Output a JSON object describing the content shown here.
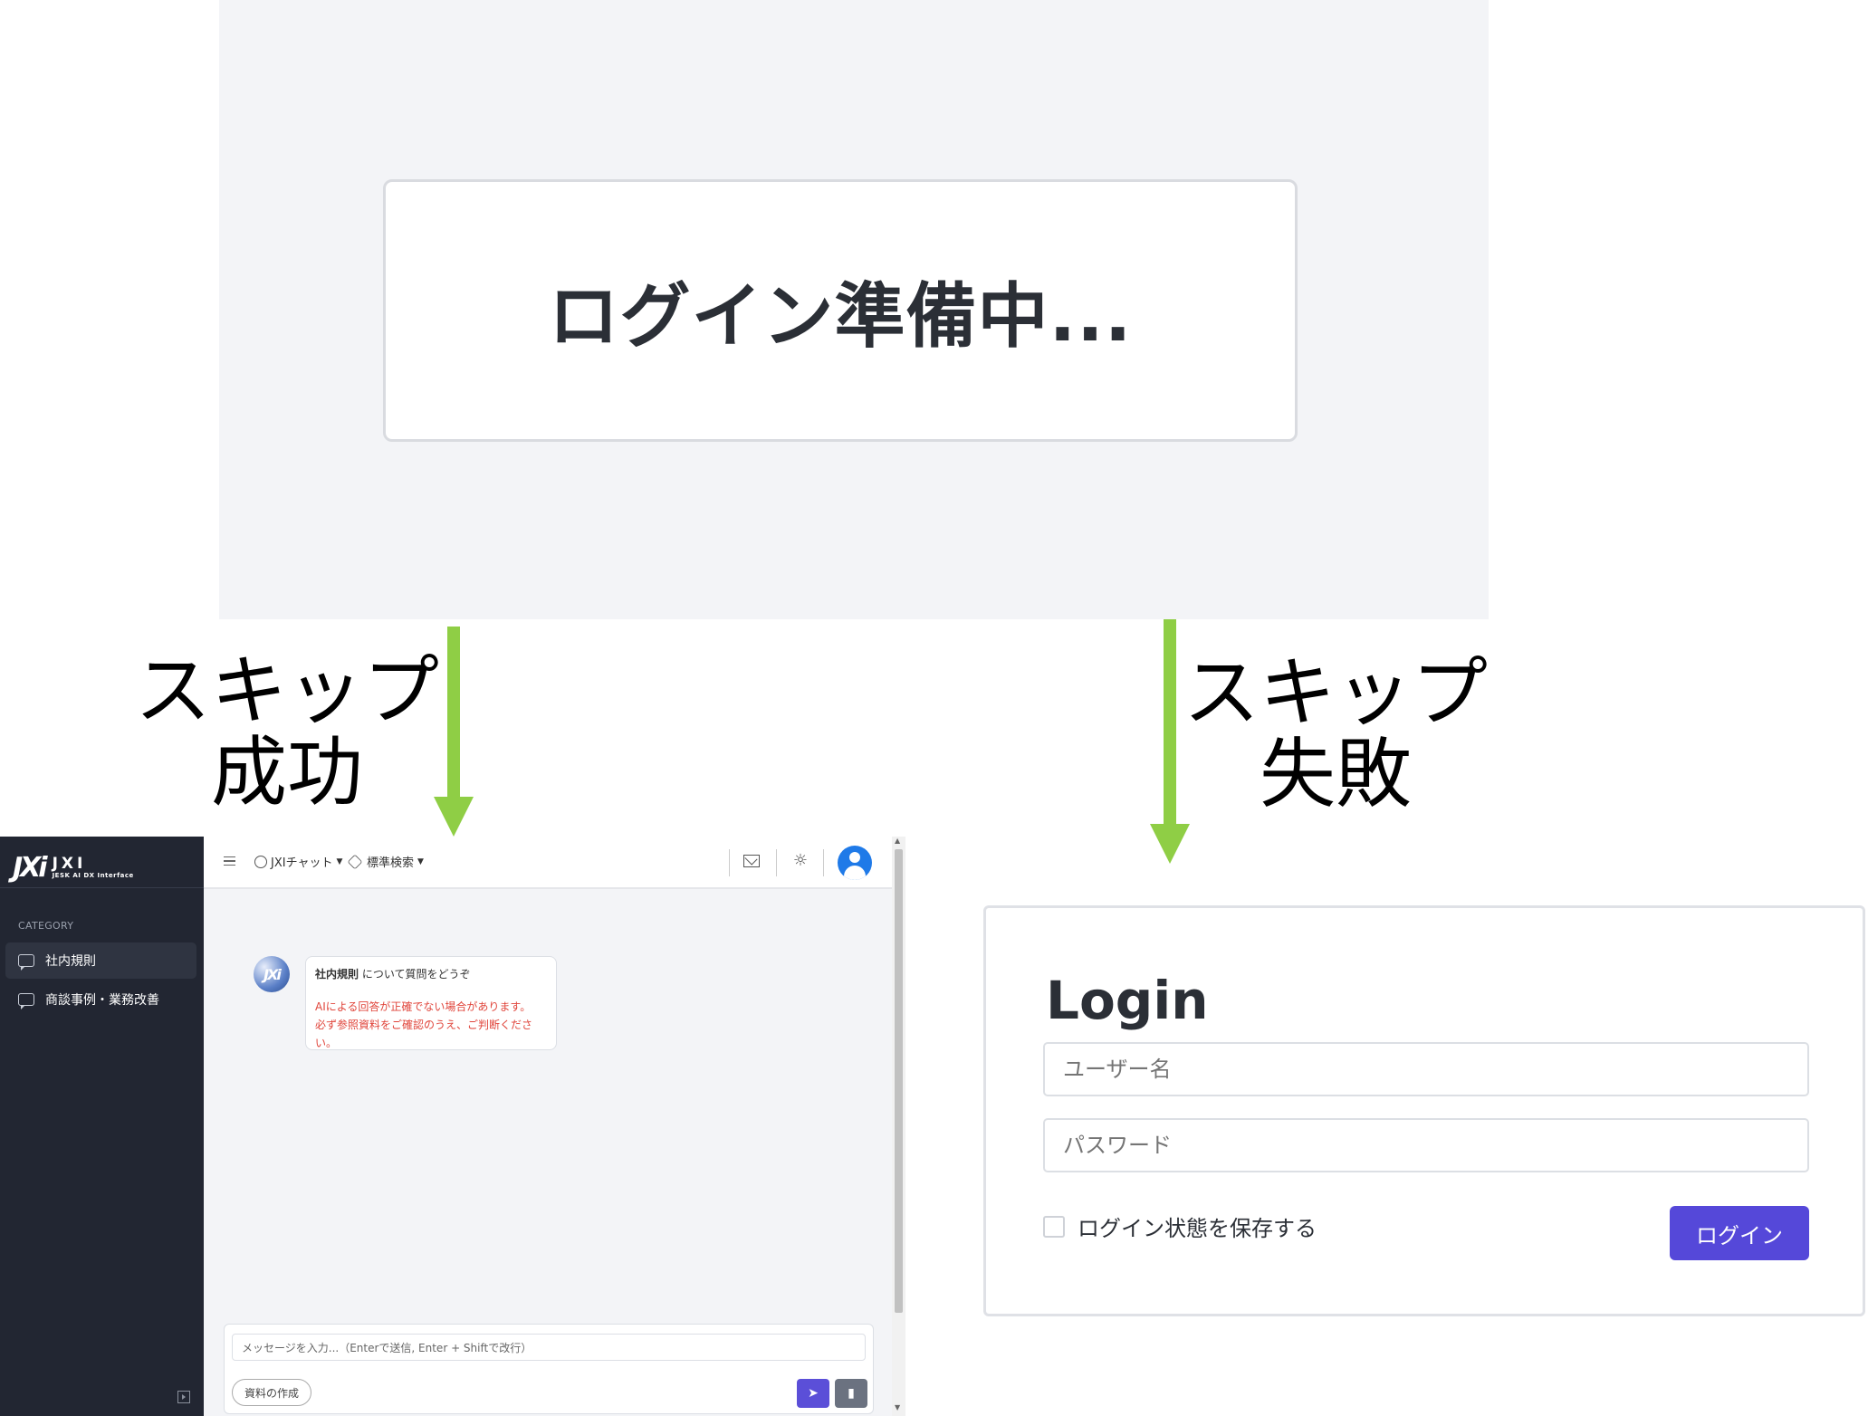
{
  "loading": {
    "text": "ログイン準備中..."
  },
  "labels": {
    "success_line1": "スキップ",
    "success_line2": "成功",
    "fail_line1": "スキップ",
    "fail_line2": "失敗"
  },
  "app": {
    "logo": {
      "mark": "JXi",
      "main": "JXI",
      "sub": "JESK AI DX Interface"
    },
    "sidebar": {
      "category_label": "CATEGORY",
      "items": [
        {
          "label": "社内規則",
          "active": true
        },
        {
          "label": "商談事例・業務改善",
          "active": false
        }
      ]
    },
    "topbar": {
      "chat_label": "JXIチャット",
      "search_label": "標準検索"
    },
    "bubble": {
      "title_bold": "社内規則",
      "title_rest": " について質問をどうぞ",
      "warn_line1": "AIによる回答が正確でない場合があります。",
      "warn_line2": "必ず参照資料をご確認のうえ、ご判断ください。"
    },
    "input": {
      "placeholder": "メッセージを入力...（Enterで送信, Enter + Shiftで改行）",
      "doc_button": "資料の作成"
    }
  },
  "login": {
    "title": "Login",
    "username_placeholder": "ユーザー名",
    "password_placeholder": "パスワード",
    "remember_label": "ログイン状態を保存する",
    "submit_label": "ログイン"
  },
  "colors": {
    "arrow": "#8fce45",
    "login_button": "#5548d9",
    "sidebar_bg": "#222632",
    "warning_text": "#e0453b"
  }
}
